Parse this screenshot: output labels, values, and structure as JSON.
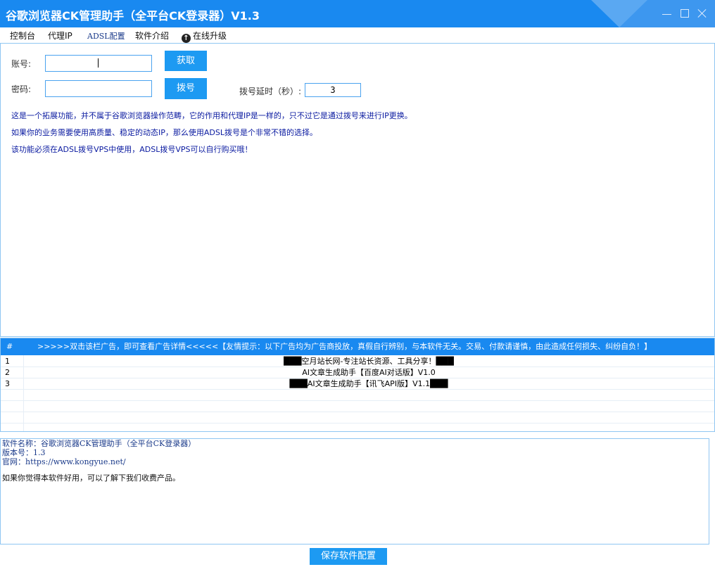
{
  "window": {
    "title": "谷歌浏览器CK管理助手（全平台CK登录器）V1.3"
  },
  "tabs": [
    {
      "label": "控制台"
    },
    {
      "label": "代理IP"
    },
    {
      "label": "ADSL配置"
    },
    {
      "label": "软件介绍"
    },
    {
      "label": "在线升级",
      "icon": "upload-circle-icon"
    }
  ],
  "adsl": {
    "account_label": "账号:",
    "account_value": "",
    "password_label": "密码:",
    "password_value": "",
    "fetch_button": "获取",
    "dial_button": "拨号",
    "delay_label": "拨号延时（秒）:",
    "delay_value": "3",
    "info": [
      "这是一个拓展功能，并不属于谷歌浏览器操作范畴，它的作用和代理IP是一样的，只不过它是通过拨号来进行IP更换。",
      "如果你的业务需要使用高质量、稳定的动态IP，那么使用ADSL拨号是个非常不错的选择。",
      "该功能必须在ADSL拨号VPS中使用，ADSL拨号VPS可以自行购买哦！"
    ]
  },
  "ads": {
    "col_num": "#",
    "col_title": ">>>>>双击该栏广告，即可查看广告详情<<<<<【友情提示：以下广告均为广告商投放，真假自行辨别，与本软件无关。交易、付款请谨慎，由此造成任何损失、纠纷自负！】",
    "rows": [
      {
        "num": "1",
        "text": "███空月站长网-专注站长资源、工具分享！███"
      },
      {
        "num": "2",
        "text": "AI文章生成助手【百度AI对话版】V1.0"
      },
      {
        "num": "3",
        "text": "███AI文章生成助手【讯飞API版】V1.1███"
      }
    ]
  },
  "about": {
    "name": "软件名称：谷歌浏览器CK管理助手（全平台CK登录器）",
    "version": "版本号：1.3",
    "site": "官网：https://www.kongyue.net/",
    "promo": "如果你觉得本软件好用，可以了解下我们收费产品。"
  },
  "save_button": "保存软件配置",
  "colors": {
    "titlebar": "#1989f0",
    "button": "#1d9af2",
    "border": "#8fc6f2",
    "info_text": "#0a1aa0"
  }
}
